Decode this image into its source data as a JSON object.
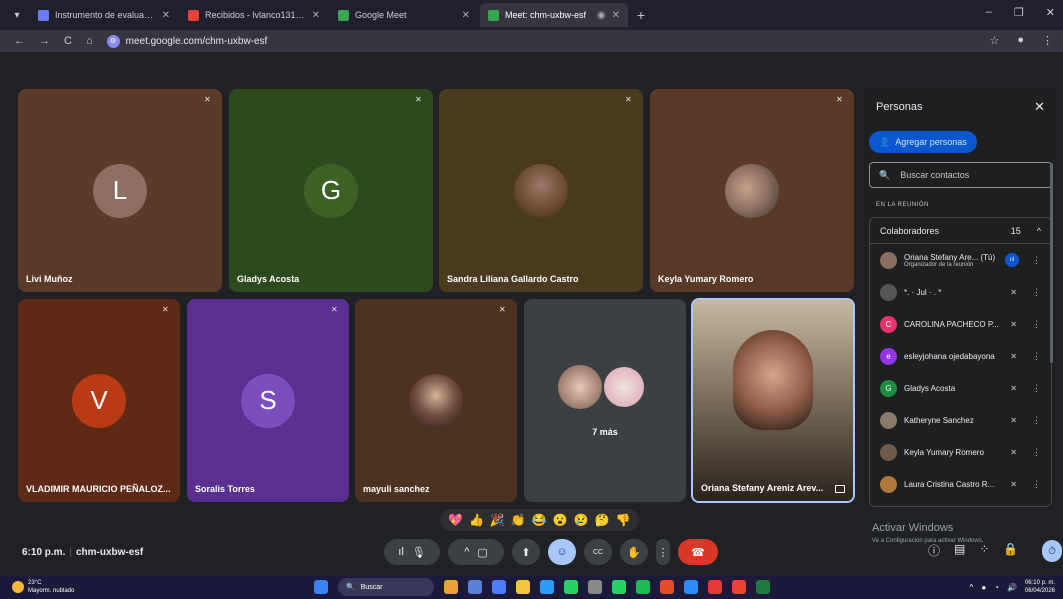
{
  "browser": {
    "tabs": [
      {
        "label": "Instrumento de evaluación",
        "fav_color": "#6a7cff"
      },
      {
        "label": "Recibidos - lvlanco1316@gmail",
        "fav_color": "#ea4335"
      },
      {
        "label": "Google Meet",
        "fav_color": "#34a853"
      },
      {
        "label": "Meet: chm-uxbw-esf",
        "fav_color": "#34a853"
      }
    ],
    "new_tab": "+",
    "url": "meet.google.com/chm-uxbw-esf",
    "nav": {
      "back": "←",
      "forward": "→",
      "reload": "C",
      "home": "⌂"
    }
  },
  "meeting": {
    "time": "6:10 p.m.",
    "code": "chm-uxbw-esf",
    "participant_badge": "15",
    "more_label": "7 más",
    "tiles": [
      {
        "name": "Livi Muñoz",
        "initial": "L",
        "bg": "#5b3a28",
        "avatar": "#8d6e63"
      },
      {
        "name": "Gladys Acosta",
        "initial": "G",
        "bg": "#2d4a1c",
        "avatar": "#3c6124"
      },
      {
        "name": "Sandra Liliana Gallardo Castro",
        "initial": "",
        "bg": "#4a3a1e",
        "avatar": "#6d4c31"
      },
      {
        "name": "Keyla Yumary Romero",
        "initial": "",
        "bg": "#5a3a26",
        "avatar": "#8a6f60"
      },
      {
        "name": "VLADIMIR MAURICIO PEÑALOZ...",
        "initial": "V",
        "bg": "#5e2a16",
        "avatar": "#b93b16"
      },
      {
        "name": "Soralis Torres",
        "initial": "S",
        "bg": "#5a2f8f",
        "avatar": "#7c4dbd"
      },
      {
        "name": "mayuli sanchez",
        "initial": "",
        "bg": "#4e3220",
        "avatar": "#3a2a22"
      },
      {
        "name": "",
        "initial": "",
        "bg": "#3c4043",
        "avatar": "#6b6b6b"
      },
      {
        "name": "Oriana Stefany Areniz Arev...",
        "initial": "",
        "bg": "#4a4036",
        "avatar": "#7a6b5d"
      }
    ],
    "reactions": [
      "💖",
      "👍",
      "🎉",
      "👏",
      "😂",
      "😮",
      "😢",
      "🤔",
      "👎"
    ]
  },
  "controls": {
    "mic_level": "ıl",
    "mic": "🎙",
    "cam_chevron": "^",
    "cam": "▢",
    "present": "⬆",
    "emoji": "☺",
    "captions": "CC",
    "hand": "✋",
    "more": "⋮",
    "end": "☎"
  },
  "panel": {
    "title": "Personas",
    "close": "✕",
    "add_label": "Agregar personas",
    "search_placeholder": "Buscar contactos",
    "section_label": "EN LA REUNIÓN",
    "group_label": "Colaboradores",
    "group_count": "15",
    "group_chevron": "^",
    "people": [
      {
        "name": "Oriana Stefany Are... (Tú)",
        "sub": "Organizador de la reunión",
        "initial": "",
        "color": "#8a6f60",
        "status": "speaking"
      },
      {
        "name": "*. · Jul · . *",
        "sub": "",
        "initial": "",
        "color": "#555",
        "status": "muted"
      },
      {
        "name": "CAROLINA PACHECO P...",
        "sub": "",
        "initial": "C",
        "color": "#e8336d",
        "status": "muted"
      },
      {
        "name": "esleyjohana ojedabayona",
        "sub": "",
        "initial": "e",
        "color": "#9334e6",
        "status": "muted"
      },
      {
        "name": "Gladys Acosta",
        "sub": "",
        "initial": "G",
        "color": "#1e8e3e",
        "status": "muted"
      },
      {
        "name": "Katheryne Sanchez",
        "sub": "",
        "initial": "",
        "color": "#8a7a6a",
        "status": "muted"
      },
      {
        "name": "Keyla Yumary Romero",
        "sub": "",
        "initial": "",
        "color": "#6f5a4a",
        "status": "muted"
      },
      {
        "name": "Laura Cristina Castro R...",
        "sub": "",
        "initial": "",
        "color": "#b0783a",
        "status": "muted"
      }
    ]
  },
  "windows": {
    "activate_title": "Activar Windows",
    "activate_sub": "Ve a Configuración para activar Windows."
  },
  "taskbar": {
    "temp": "23°C",
    "weather": "Mayorm. nublado",
    "search": "Buscar",
    "time": "06:10 p. m.",
    "date": "06/04/2026"
  }
}
